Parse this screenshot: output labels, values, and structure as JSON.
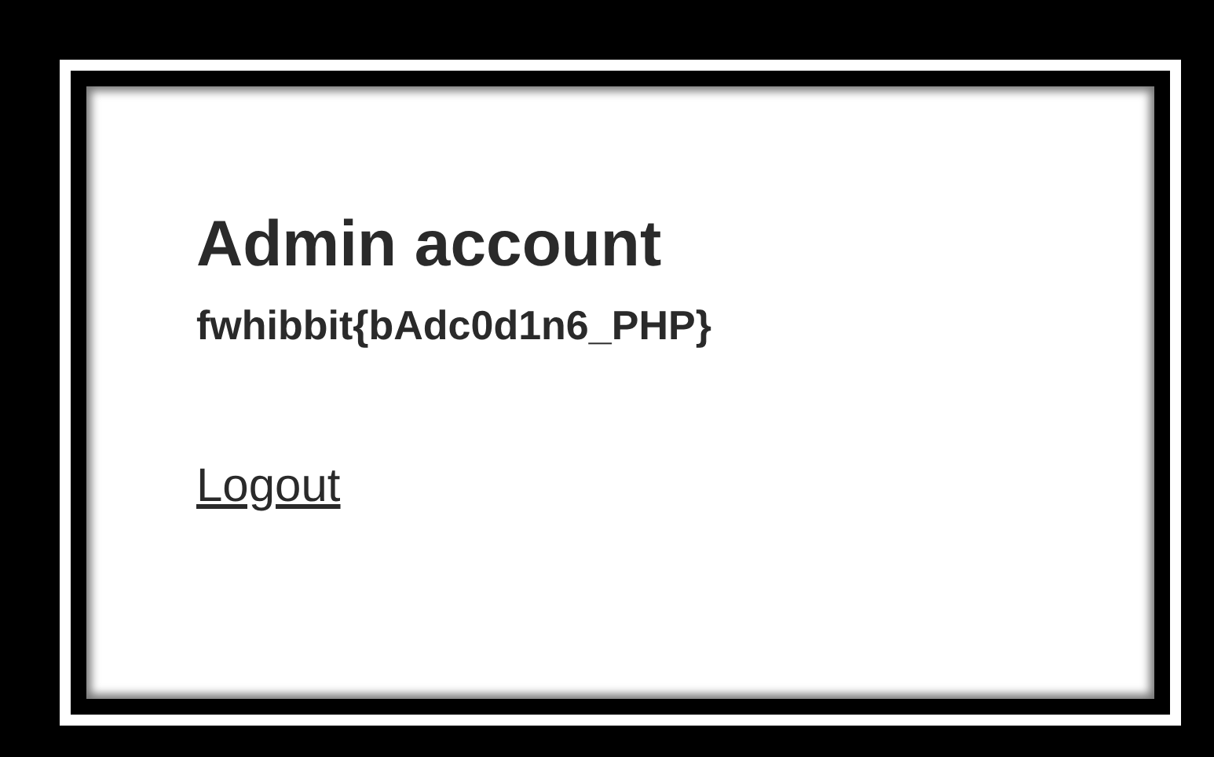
{
  "heading": "Admin account",
  "flag": "fwhibbit{bAdc0d1n6_PHP}",
  "link": "Logout"
}
